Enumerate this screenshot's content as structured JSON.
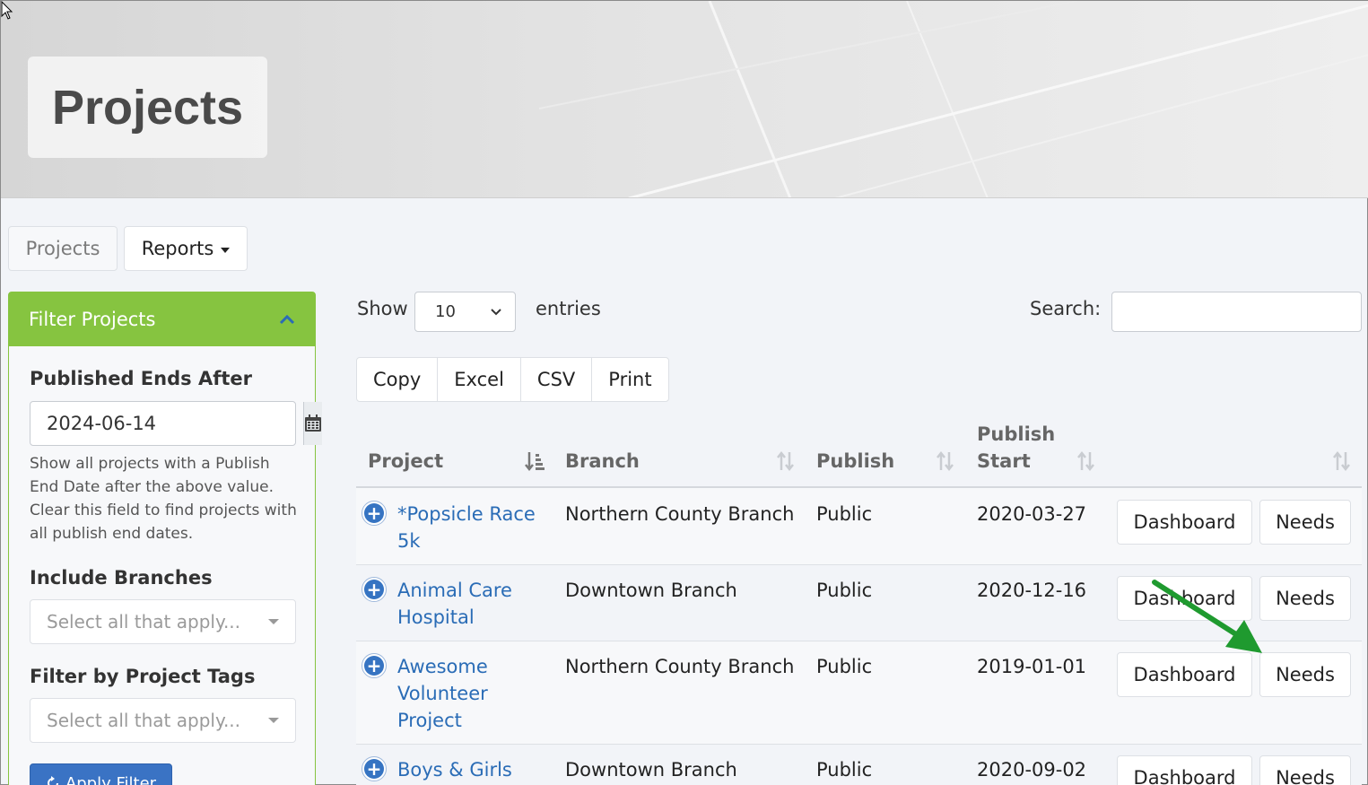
{
  "page": {
    "title": "Projects"
  },
  "nav": {
    "tab_projects": "Projects",
    "tab_reports": "Reports"
  },
  "filter": {
    "heading": "Filter Projects",
    "published_ends_label": "Published Ends After",
    "published_ends_value": "2024-06-14",
    "help_text": "Show all projects with a Publish End Date after the above value. Clear this field to find projects with all publish end dates.",
    "branches_label": "Include Branches",
    "branches_placeholder": "Select all that apply...",
    "tags_label": "Filter by Project Tags",
    "tags_placeholder": "Select all that apply...",
    "apply_label": "Apply Filter"
  },
  "table_controls": {
    "show_label": "Show",
    "page_length": "10",
    "entries_label": "entries",
    "search_label": "Search:",
    "search_value": "",
    "export": [
      "Copy",
      "Excel",
      "CSV",
      "Print"
    ]
  },
  "columns": {
    "project": "Project",
    "branch": "Branch",
    "publish": "Publish",
    "publish_start_1": "Publish",
    "publish_start_2": "Start"
  },
  "rows": [
    {
      "project_1": "*Popsicle Race",
      "project_2": "5k",
      "project_3": "",
      "branch": "Northern County Branch",
      "publish": "Public",
      "start": "2020-03-27",
      "dashboard": "Dashboard",
      "needs": "Needs"
    },
    {
      "project_1": "Animal Care",
      "project_2": "Hospital",
      "project_3": "",
      "branch": "Downtown Branch",
      "publish": "Public",
      "start": "2020-12-16",
      "dashboard": "Dashboard",
      "needs": "Needs"
    },
    {
      "project_1": "Awesome",
      "project_2": "Volunteer",
      "project_3": "Project",
      "branch": "Northern County Branch",
      "publish": "Public",
      "start": "2019-01-01",
      "dashboard": "Dashboard",
      "needs": "Needs"
    },
    {
      "project_1": "Boys & Girls",
      "project_2": "",
      "project_3": "",
      "branch": "Downtown Branch",
      "publish": "Public",
      "start": "2020-09-02",
      "dashboard": "Dashboard",
      "needs": "Needs"
    }
  ],
  "colors": {
    "accent_green": "#86c440",
    "link_blue": "#2a6cb6",
    "annotation_arrow": "#1f9a2f"
  },
  "icons": {
    "calendar": "calendar-icon",
    "collapse": "chevron-up-icon",
    "expand_row": "plus-circle-icon",
    "arrow": "arrow-annotation-icon"
  }
}
